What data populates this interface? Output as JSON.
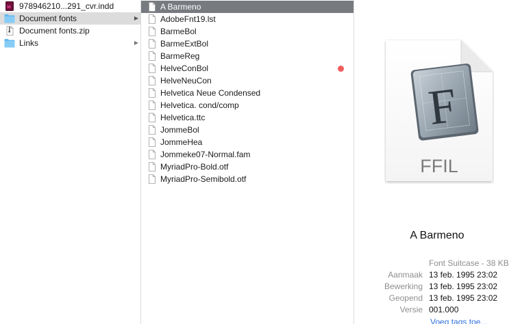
{
  "column1": {
    "items": [
      {
        "label": "978946210...291_cvr.indd",
        "icon": "indesign-file-icon"
      },
      {
        "label": "Document fonts",
        "icon": "folder-icon",
        "has_children": true,
        "selected": true
      },
      {
        "label": "Document fonts.zip",
        "icon": "zip-file-icon"
      },
      {
        "label": "Links",
        "icon": "folder-icon",
        "has_children": true
      }
    ]
  },
  "column2": {
    "items": [
      {
        "label": "A Barmeno",
        "selected": true
      },
      {
        "label": "AdobeFnt19.lst"
      },
      {
        "label": "BarmeBol"
      },
      {
        "label": "BarmeExtBol"
      },
      {
        "label": "BarmeReg"
      },
      {
        "label": "HelveConBol",
        "tag": "red"
      },
      {
        "label": "HelveNeuCon"
      },
      {
        "label": "Helvetica Neue Condensed"
      },
      {
        "label": "Helvetica. cond/comp"
      },
      {
        "label": "Helvetica.ttc"
      },
      {
        "label": "JommeBol"
      },
      {
        "label": "JommeHea"
      },
      {
        "label": "Jommeke07-Normal.fam"
      },
      {
        "label": "MyriadPro-Bold.otf"
      },
      {
        "label": "MyriadPro-Semibold.otf"
      }
    ]
  },
  "preview": {
    "icon_text": "FFIL",
    "icon_letter": "F",
    "title": "A Barmeno",
    "kind": "Font Suitcase - 38 KB",
    "meta": [
      {
        "key": "Aanmaak",
        "value": "13 feb. 1995 23:02"
      },
      {
        "key": "Bewerking",
        "value": "13 feb. 1995 23:02"
      },
      {
        "key": "Geopend",
        "value": "13 feb. 1995 23:02"
      },
      {
        "key": "Versie",
        "value": "001.000"
      }
    ],
    "add_tags": "Voeg tags toe..."
  },
  "colors": {
    "selection_active": "#777b80",
    "selection_inactive": "#dcdcdc",
    "folder": "#63b9f0",
    "tag_red": "#ef5c5c",
    "link": "#2f6fdc"
  }
}
